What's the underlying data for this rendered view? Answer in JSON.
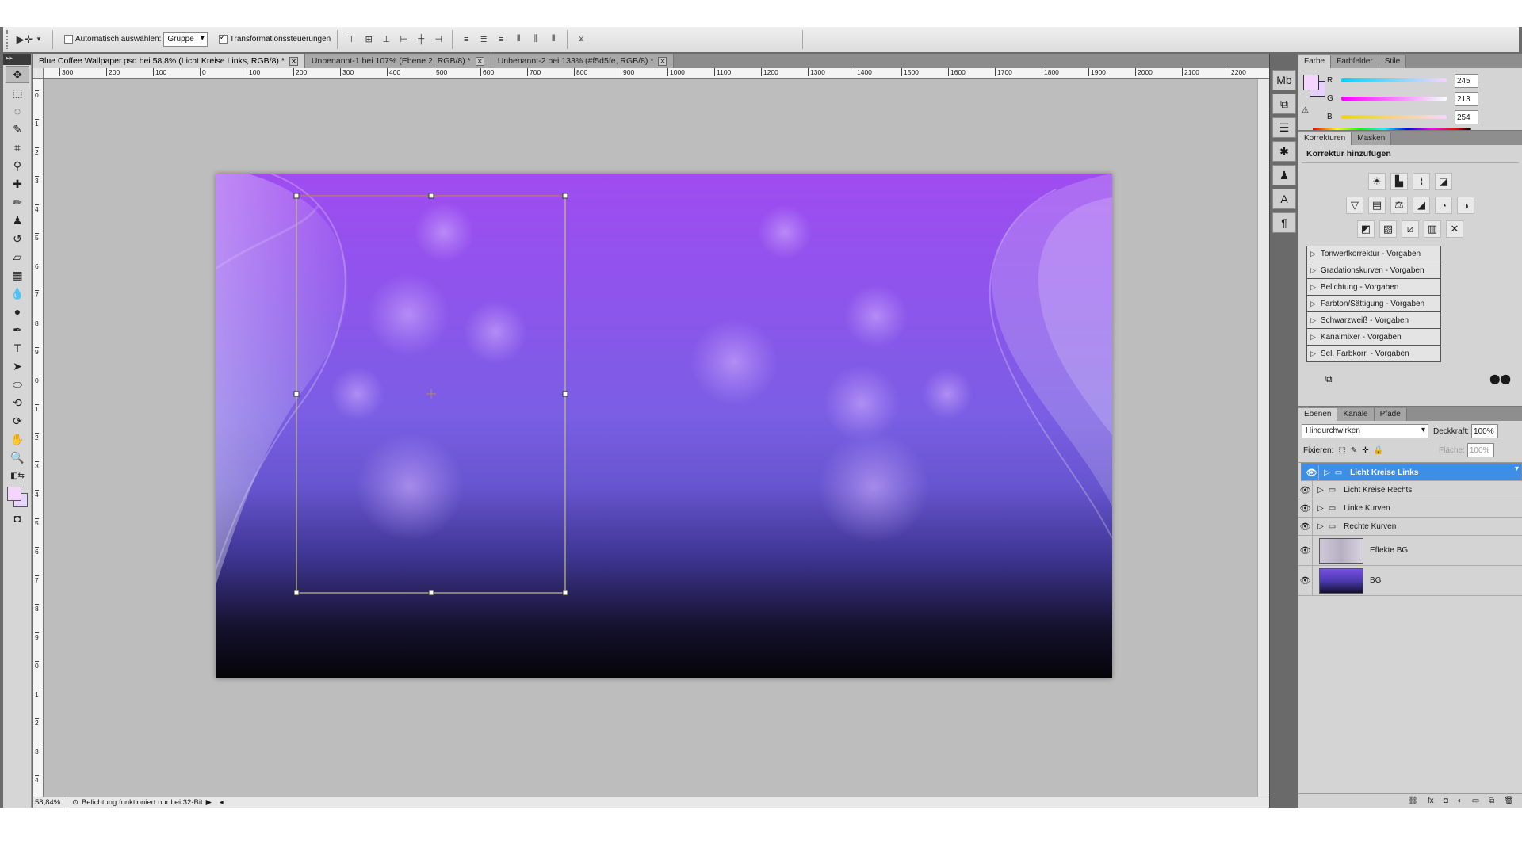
{
  "options_bar": {
    "auto_select_label": "Automatisch auswählen:",
    "auto_select_value": "Gruppe",
    "transform_label": "Transformationssteuerungen"
  },
  "tabs": [
    {
      "label": "Blue Coffee Wallpaper.psd bei 58,8% (Licht Kreise Links, RGB/8) *"
    },
    {
      "label": "Unbenannt-1 bei 107% (Ebene 2, RGB/8) *"
    },
    {
      "label": "Unbenannt-2 bei 133% (#f5d5fe, RGB/8) *"
    }
  ],
  "ruler": {
    "h_ticks": [
      "300",
      "200",
      "100",
      "0",
      "100",
      "200",
      "300",
      "400",
      "500",
      "600",
      "700",
      "800",
      "900",
      "1000",
      "1100",
      "1200",
      "1300",
      "1400",
      "1500",
      "1600",
      "1700",
      "1800",
      "1900",
      "2000",
      "2100",
      "2200"
    ],
    "v_ticks": [
      "0",
      "1",
      "2",
      "3",
      "4",
      "5",
      "6",
      "7",
      "8",
      "9",
      "0",
      "1",
      "2",
      "3",
      "4",
      "5",
      "6",
      "7",
      "8",
      "9",
      "0",
      "1",
      "2",
      "3",
      "4"
    ]
  },
  "status": {
    "zoom": "58,84%",
    "message": "Belichtung funktioniert nur bei 32-Bit"
  },
  "color_panel": {
    "tabs": [
      "Farbe",
      "Farbfelder",
      "Stile"
    ],
    "channels": [
      {
        "label": "R",
        "value": "245"
      },
      {
        "label": "G",
        "value": "213"
      },
      {
        "label": "B",
        "value": "254"
      }
    ],
    "foreground_color": "#f5d5fe"
  },
  "adjustments_panel": {
    "tabs": [
      "Korrekturen",
      "Masken"
    ],
    "title": "Korrektur hinzufügen",
    "presets": [
      "Tonwertkorrektur - Vorgaben",
      "Gradationskurven - Vorgaben",
      "Belichtung - Vorgaben",
      "Farbton/Sättigung - Vorgaben",
      "Schwarzweiß - Vorgaben",
      "Kanalmixer - Vorgaben",
      "Sel. Farbkorr. - Vorgaben"
    ]
  },
  "layers_panel": {
    "tabs": [
      "Ebenen",
      "Kanäle",
      "Pfade"
    ],
    "blend_mode": "Hindurchwirken",
    "opacity_label": "Deckkraft:",
    "opacity_value": "100%",
    "lock_label": "Fixieren:",
    "fill_label": "Fläche:",
    "fill_value": "100%",
    "layers": [
      {
        "name": "Licht Kreise Links",
        "type": "group",
        "selected": true
      },
      {
        "name": "Licht Kreise Rechts",
        "type": "group",
        "selected": false
      },
      {
        "name": "Linke Kurven",
        "type": "group",
        "selected": false
      },
      {
        "name": "Rechte Kurven",
        "type": "group",
        "selected": false
      },
      {
        "name": "Effekte BG",
        "type": "layer",
        "selected": false
      },
      {
        "name": "BG",
        "type": "layer",
        "selected": false
      }
    ]
  },
  "colors": {
    "selection_blue": "#3d8ee6",
    "canvas_top": "#9f4cf0",
    "canvas_bottom": "#050408"
  }
}
